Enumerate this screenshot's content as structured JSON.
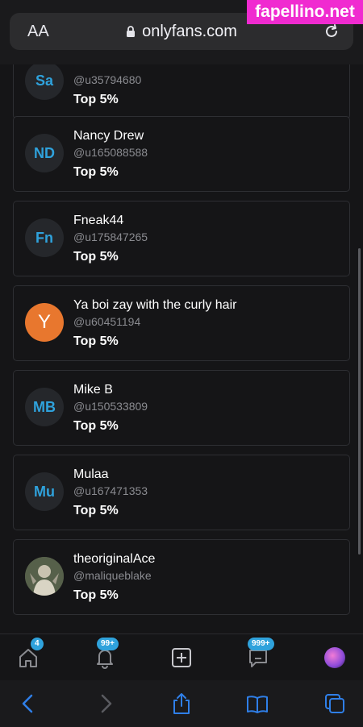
{
  "browser": {
    "text_size_label": "AA",
    "domain": "onlyfans.com"
  },
  "watermark": "fapellino.net",
  "cards": [
    {
      "initials": "Sa",
      "name": "",
      "handle": "@u35794680",
      "rank": "Top 5%"
    },
    {
      "initials": "ND",
      "name": "Nancy Drew",
      "handle": "@u165088588",
      "rank": "Top 5%"
    },
    {
      "initials": "Fn",
      "name": "Fneak44",
      "handle": "@u175847265",
      "rank": "Top 5%"
    },
    {
      "initials": "Y",
      "name": "Ya boi zay with the curly hair",
      "handle": "@u60451194",
      "rank": "Top 5%"
    },
    {
      "initials": "MB",
      "name": "Mike B",
      "handle": "@u150533809",
      "rank": "Top 5%"
    },
    {
      "initials": "Mu",
      "name": "Mulaa",
      "handle": "@u167471353",
      "rank": "Top 5%"
    },
    {
      "initials": "",
      "name": "theoriginalAce",
      "handle": "@maliqueblake",
      "rank": "Top 5%"
    }
  ],
  "bottom_nav": {
    "home_badge": "4",
    "notifications_badge": "99+",
    "messages_badge": "999+"
  },
  "icons": {
    "home": "home-icon",
    "notifications": "bell-icon",
    "add": "plus-square-icon",
    "messages": "message-icon",
    "profile": "avatar",
    "back": "chevron-left-icon",
    "forward": "chevron-right-icon",
    "share": "share-icon",
    "bookmarks": "book-icon",
    "tabs": "tabs-icon"
  },
  "colors": {
    "accent": "#2fa2dc",
    "avatar_orange": "#e8772e",
    "watermark": "#f02bd0"
  }
}
